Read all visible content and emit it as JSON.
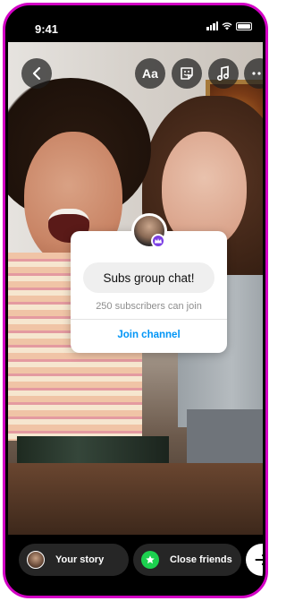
{
  "status_bar": {
    "time": "9:41"
  },
  "toolbar": {
    "text_tool_label": "Aa"
  },
  "channel_sticker": {
    "title": "Subs group chat!",
    "subtitle": "250 subscribers can join",
    "action_label": "Join channel"
  },
  "share_bar": {
    "your_story_label": "Your story",
    "close_friends_label": "Close friends"
  },
  "colors": {
    "frame_border": "#d300c5",
    "link_blue": "#0095f6",
    "close_friends_green": "#1cd14f",
    "badge_purple": "#7b3fe4"
  },
  "icons": [
    "chevron-left-icon",
    "sticker-icon",
    "music-note-icon",
    "more-dots-icon",
    "star-icon",
    "arrow-right-icon",
    "signal-icon",
    "wifi-icon",
    "battery-icon"
  ]
}
